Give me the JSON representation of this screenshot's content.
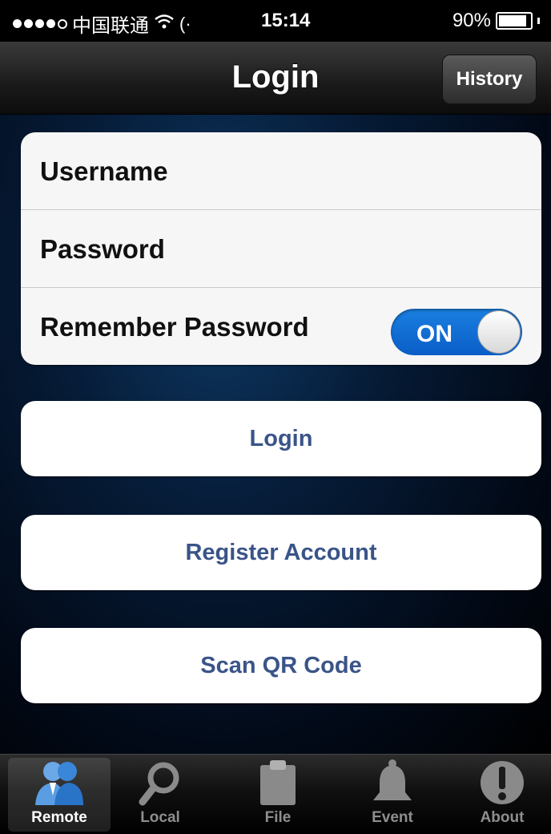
{
  "status_bar": {
    "carrier": "中国联通",
    "time": "15:14",
    "battery": "90%",
    "battery_level": 0.9
  },
  "nav": {
    "title": "Login",
    "history_label": "History"
  },
  "form": {
    "username_label": "Username",
    "password_label": "Password",
    "remember_label": "Remember Password",
    "remember_state": "ON"
  },
  "buttons": {
    "login": "Login",
    "register": "Register Account",
    "scan": "Scan QR Code"
  },
  "tabs": [
    {
      "label": "Remote",
      "icon": "remote-users-icon",
      "selected": true
    },
    {
      "label": "Local",
      "icon": "search-icon",
      "selected": false
    },
    {
      "label": "File",
      "icon": "clipboard-icon",
      "selected": false
    },
    {
      "label": "Event",
      "icon": "bell-icon",
      "selected": false
    },
    {
      "label": "About",
      "icon": "exclamation-icon",
      "selected": false
    }
  ],
  "colors": {
    "accent_blue": "#1a7fe0",
    "button_text": "#3a5488"
  }
}
